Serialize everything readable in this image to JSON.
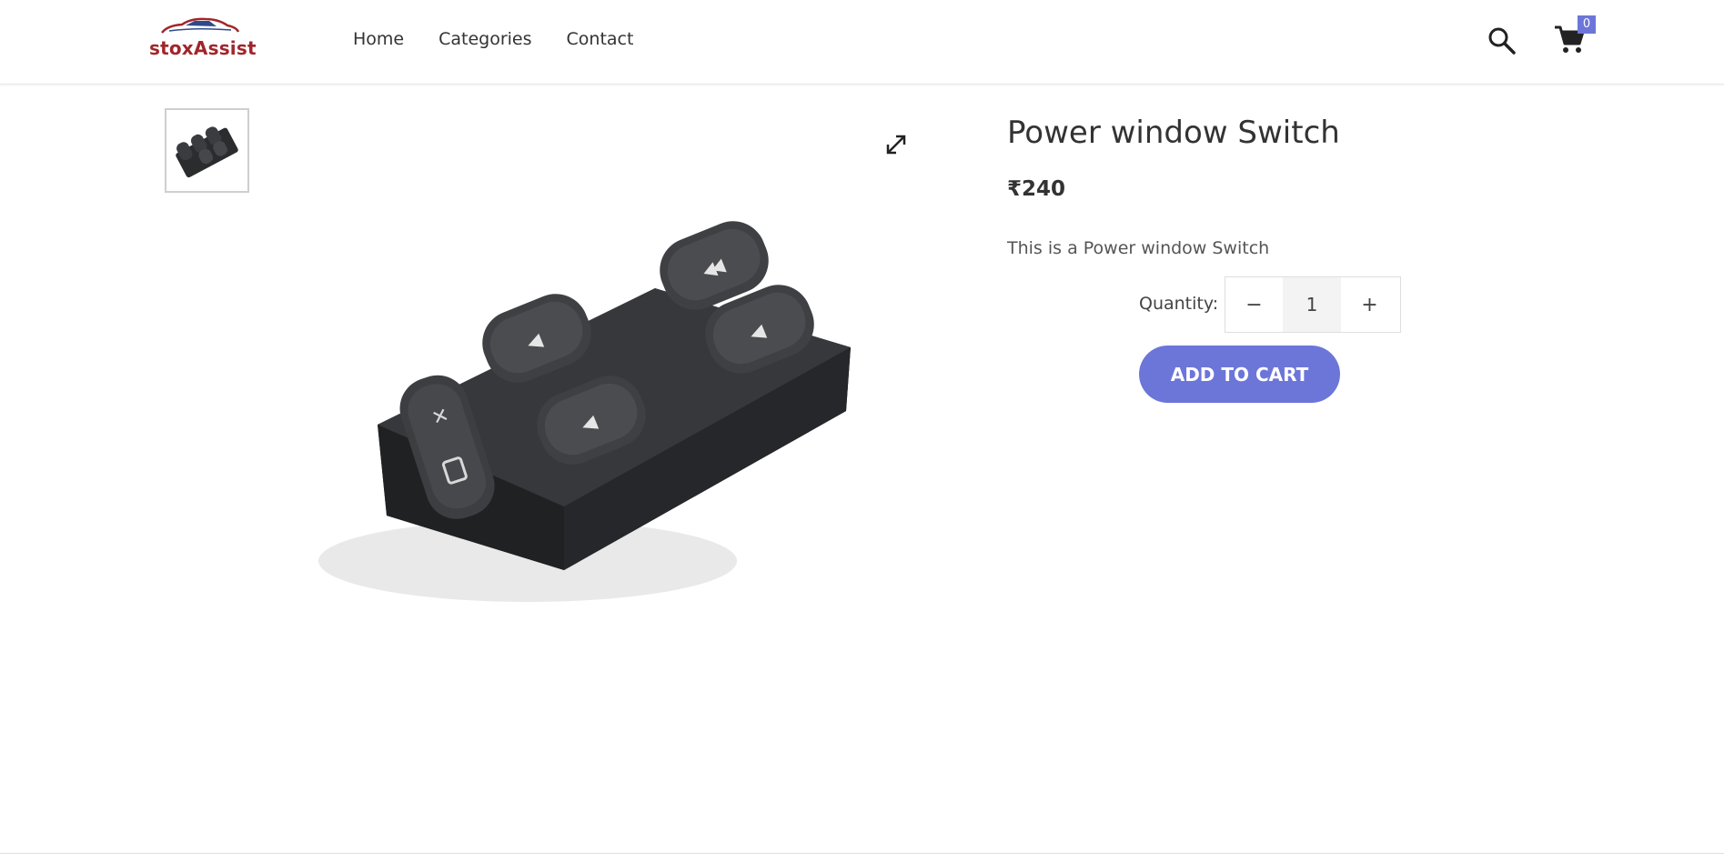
{
  "brand": {
    "logo_text": "stoxAssist",
    "color": "#a0262b"
  },
  "nav": {
    "items": [
      {
        "label": "Home"
      },
      {
        "label": "Categories"
      },
      {
        "label": "Contact"
      }
    ]
  },
  "header": {
    "search_icon": "search-icon",
    "cart_icon": "cart-icon",
    "cart_count": "0"
  },
  "gallery": {
    "thumbnail_alt": "Power window Switch",
    "expand_icon": "expand-icon"
  },
  "product": {
    "title": "Power window Switch",
    "price": "₹240",
    "description": "This is a Power window Switch",
    "quantity_label": "Quantity:",
    "quantity_value": "1",
    "decrement_symbol": "−",
    "increment_symbol": "+",
    "add_to_cart_label": "ADD TO CART"
  },
  "colors": {
    "accent": "#6c76d8",
    "brand_red": "#a0262b",
    "text": "#333333"
  }
}
